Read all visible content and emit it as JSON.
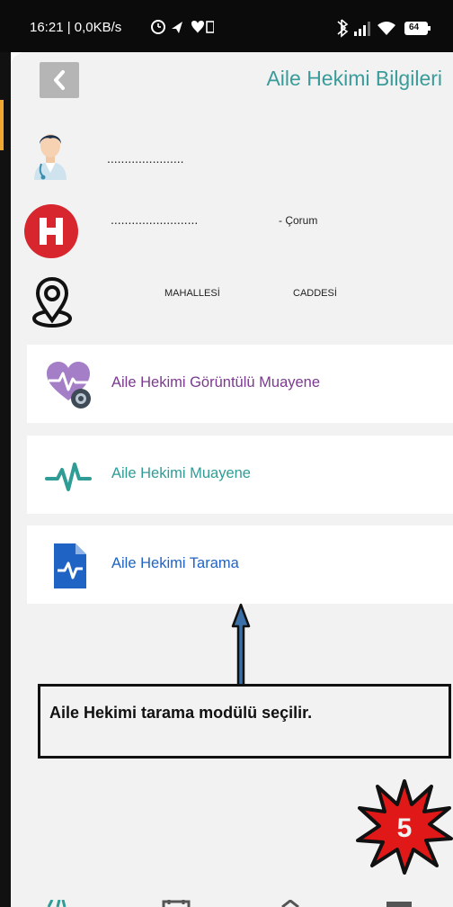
{
  "status_bar": {
    "time": "16:21 | 0,0KB/s",
    "battery": "64"
  },
  "header": {
    "back_icon": "chevron-left-icon",
    "title": "Aile Hekimi Bilgileri"
  },
  "doctor": {
    "icon": "doctor-avatar-icon",
    "name": "......................"
  },
  "hospital": {
    "icon": "hospital-h-icon",
    "name": ".........................",
    "city": "- Çorum"
  },
  "address": {
    "icon": "location-pin-icon",
    "neighborhood": "MAHALLESİ",
    "street": "CADDESİ"
  },
  "menu": {
    "video_exam": {
      "label": "Aile Hekimi Görüntülü Muayene",
      "icon": "heart-camera-icon",
      "color": "#7b3a8f"
    },
    "exam": {
      "label": "Aile Hekimi Muayene",
      "icon": "heartbeat-icon",
      "color": "#2f9c96"
    },
    "screening": {
      "label": "Aile Hekimi Tarama",
      "icon": "document-pulse-icon",
      "color": "#1f63c5"
    }
  },
  "annotation": {
    "text": "Aile Hekimi tarama modülü seçilir.",
    "step_badge": "5"
  },
  "bottom_nav": {
    "items": [
      "home-icon",
      "calendar-icon",
      "up-icon",
      "menu-icon"
    ]
  },
  "colors": {
    "teal": "#3a9c9a",
    "hospital_red": "#d8262f",
    "screen_bg": "#f2f2f2"
  }
}
